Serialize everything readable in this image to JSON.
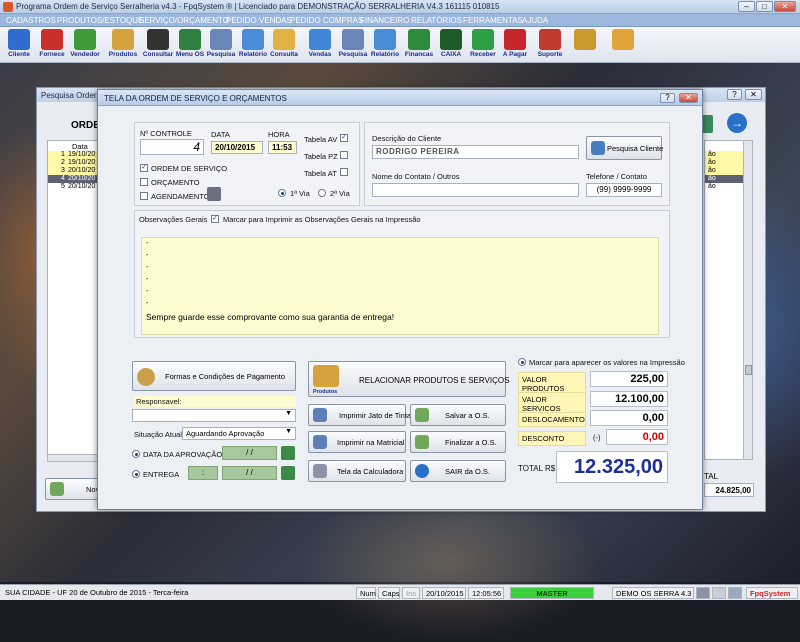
{
  "window": {
    "title": "Programa Ordem de Serviço Serralheria v4.3 - FpqSystem ® | Licenciado para  DEMONSTRAÇÃO SERRALHERIA V4.3 161115 010815"
  },
  "menu": [
    "CADASTROS",
    "PRODUTOS/ESTOQUE",
    "SERVIÇO/ORÇAMENTO",
    "PEDIDO VENDAS",
    "PEDIDO COMPRAS",
    "FINANCEIRO",
    "RELATÓRIOS",
    "FERRAMENTAS",
    "AJUDA"
  ],
  "toolbar": [
    {
      "label": "Cliente",
      "icon": "client-icon",
      "color": "#2f6ccf"
    },
    {
      "label": "Fornece",
      "icon": "supplier-icon",
      "color": "#c9302c"
    },
    {
      "label": "Vendedor",
      "icon": "seller-icon",
      "color": "#3d9b3a"
    },
    {
      "label": "Produtos",
      "icon": "boxes-icon",
      "color": "#d6a23b"
    },
    {
      "label": "Consultar",
      "icon": "barcode-icon",
      "color": "#333333"
    },
    {
      "label": "Menu OS",
      "icon": "os-icon",
      "color": "#2f7f3f"
    },
    {
      "label": "Pesquisa",
      "icon": "search-doc-icon",
      "color": "#6a86b8"
    },
    {
      "label": "Relatório",
      "icon": "report-icon",
      "color": "#4a8cd8"
    },
    {
      "label": "Consulta",
      "icon": "folder-icon",
      "color": "#e2b240"
    },
    {
      "label": "Vendas",
      "icon": "monitor-icon",
      "color": "#3f87d6"
    },
    {
      "label": "Pesquisa",
      "icon": "search-doc-icon",
      "color": "#6a86b8"
    },
    {
      "label": "Relatório",
      "icon": "report-icon",
      "color": "#4a8cd8"
    },
    {
      "label": "Financas",
      "icon": "finance-icon",
      "color": "#2e8b3a"
    },
    {
      "label": "CAIXA",
      "icon": "cash-icon",
      "color": "#1f5a2a"
    },
    {
      "label": "Receber",
      "icon": "dollar-green-icon",
      "color": "#2ea043"
    },
    {
      "label": "A Pagar",
      "icon": "dollar-red-icon",
      "color": "#c8252c"
    },
    {
      "label": "Suporte",
      "icon": "support-icon",
      "color": "#c23a2e"
    },
    {
      "label": "",
      "icon": "coins-icon",
      "color": "#c99a2e"
    },
    {
      "label": "",
      "icon": "exit-icon",
      "color": "#e0a43a"
    }
  ],
  "bg_window": {
    "title": "Pesquisa Order",
    "heading": "ORDEM",
    "col_date": "Data",
    "rows": [
      {
        "n": "1",
        "d": "19/10/20"
      },
      {
        "n": "2",
        "d": "19/10/20"
      },
      {
        "n": "3",
        "d": "20/10/20"
      },
      {
        "n": "4",
        "d": "20/10/20"
      },
      {
        "n": "5",
        "d": "20/10/20"
      }
    ],
    "right_rows": [
      "ão",
      "ão",
      "ão",
      "ão",
      "ão"
    ],
    "total_label": "TAL",
    "total_value": "24.825,00",
    "nov_label": "Nov"
  },
  "dialog": {
    "title": "TELA DA ORDEM DE SERVIÇO E ORÇAMENTOS",
    "controle_label": "Nº CONTROLE",
    "controle_value": "4",
    "data_label": "DATA",
    "data_value": "20/10/2015",
    "hora_label": "HORA",
    "hora_value": "11:53",
    "tabela_av": "Tabela AV",
    "tabela_pz": "Tabela PZ",
    "tabela_at": "Tabela AT",
    "opt_os": "ORDEM DE SERVIÇO",
    "opt_orc": "ORÇAMENTO",
    "opt_ag": "AGENDAMENTO",
    "via1": "1ª Via",
    "via2": "2ª Via",
    "desc_cliente_label": "Descrição do Cliente",
    "cliente_value": "RODRIGO PEREIRA",
    "pesquisa_cliente": "Pesquisa Cliente",
    "contato_label": "Nome do Contato / Outros",
    "contato_value": "",
    "telefone_label": "Telefone / Contato",
    "telefone_value": "(99) 9999-9999",
    "obs_label": "Observações Gerais",
    "obs_check_label": "Marcar para Imprimir as Observações Gerais na Impressão",
    "obs_lines": [
      "-",
      "-",
      "-",
      "-",
      "-",
      "-"
    ],
    "obs_footer": "Sempre guarde esse comprovante como sua garantia de entrega!",
    "formas_btn": "Formas e Condições de Pagamento",
    "responsavel_label": "Responsavel:",
    "situacao_label": "Situação Atual",
    "situacao_value": "Aguardando Aprovação",
    "data_aprov_label": "DATA DA APROVAÇÃO",
    "data_aprov_value": "/ /",
    "entrega_label": "ENTREGA",
    "entrega_time": ":",
    "entrega_value": "/ /",
    "relacionar_btn": "RELACIONAR PRODUTOS E SERVIÇOS",
    "relacionar_icon_label": "Produtos",
    "jato_btn": "Imprimir Jato de Tinta",
    "salvar_btn": "Salvar a O.S.",
    "matricial_btn": "Imprimir na Matricial",
    "finalizar_btn": "Finalizar a O.S.",
    "calc_btn": "Tela da Calculadora",
    "sair_btn": "SAIR da O.S.",
    "marcar_valores": "Marcar para aparecer os valores na Impressão",
    "valor_produtos_label": "VALOR PRODUTOS",
    "valor_produtos": "225,00",
    "valor_servicos_label": "VALOR SERVICOS",
    "valor_servicos": "12.100,00",
    "deslocamento_label": "DESLOCAMENTO",
    "deslocamento": "0,00",
    "desconto_label": "DESCONTO",
    "desconto_sign": "(-)",
    "desconto": "0,00",
    "total_label": "TOTAL R$",
    "total": "12.325,00"
  },
  "status": {
    "cidade": "SUA CIDADE - UF 20 de Outubro de 2015 - Terca-feira",
    "num": "Num",
    "caps": "Caps",
    "ins": "Ins",
    "date": "20/10/2015",
    "time": "12:05:56",
    "master": "MASTER",
    "demo": "DEMO OS SERRA 4.3",
    "brand": "FpqSystem"
  },
  "colors": {
    "accent_blue": "#1c3f8c",
    "yellow_field": "#fffbd0",
    "value_red": "#d00000"
  }
}
